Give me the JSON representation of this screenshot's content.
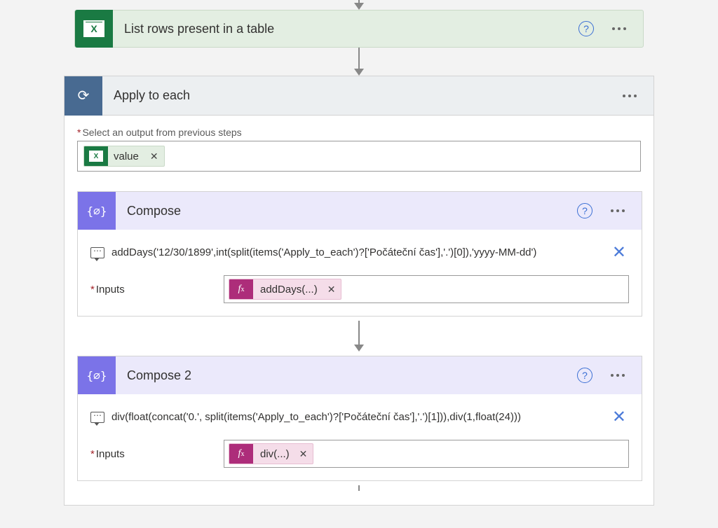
{
  "colors": {
    "excel_green": "#1a7a43",
    "compose_purple": "#7b73e8",
    "apply_blue": "#486a91",
    "fx_magenta": "#ad2d7a",
    "help_blue": "#3b6fd4"
  },
  "excelAction": {
    "title": "List rows present in a table"
  },
  "applyToEach": {
    "title": "Apply to each",
    "selectLabel": "Select an output from previous steps",
    "valueChipLabel": "value"
  },
  "compose": [
    {
      "title": "Compose",
      "expression": "addDays('12/30/1899',int(split(items('Apply_to_each')?['Počáteční čas'],'.')[0]),'yyyy-MM-dd')",
      "inputsLabel": "Inputs",
      "chipLabel": "addDays(...)"
    },
    {
      "title": "Compose 2",
      "expression": "div(float(concat('0.', split(items('Apply_to_each')?['Počáteční čas'],'.')[1])),div(1,float(24)))",
      "inputsLabel": "Inputs",
      "chipLabel": "div(...)"
    }
  ]
}
